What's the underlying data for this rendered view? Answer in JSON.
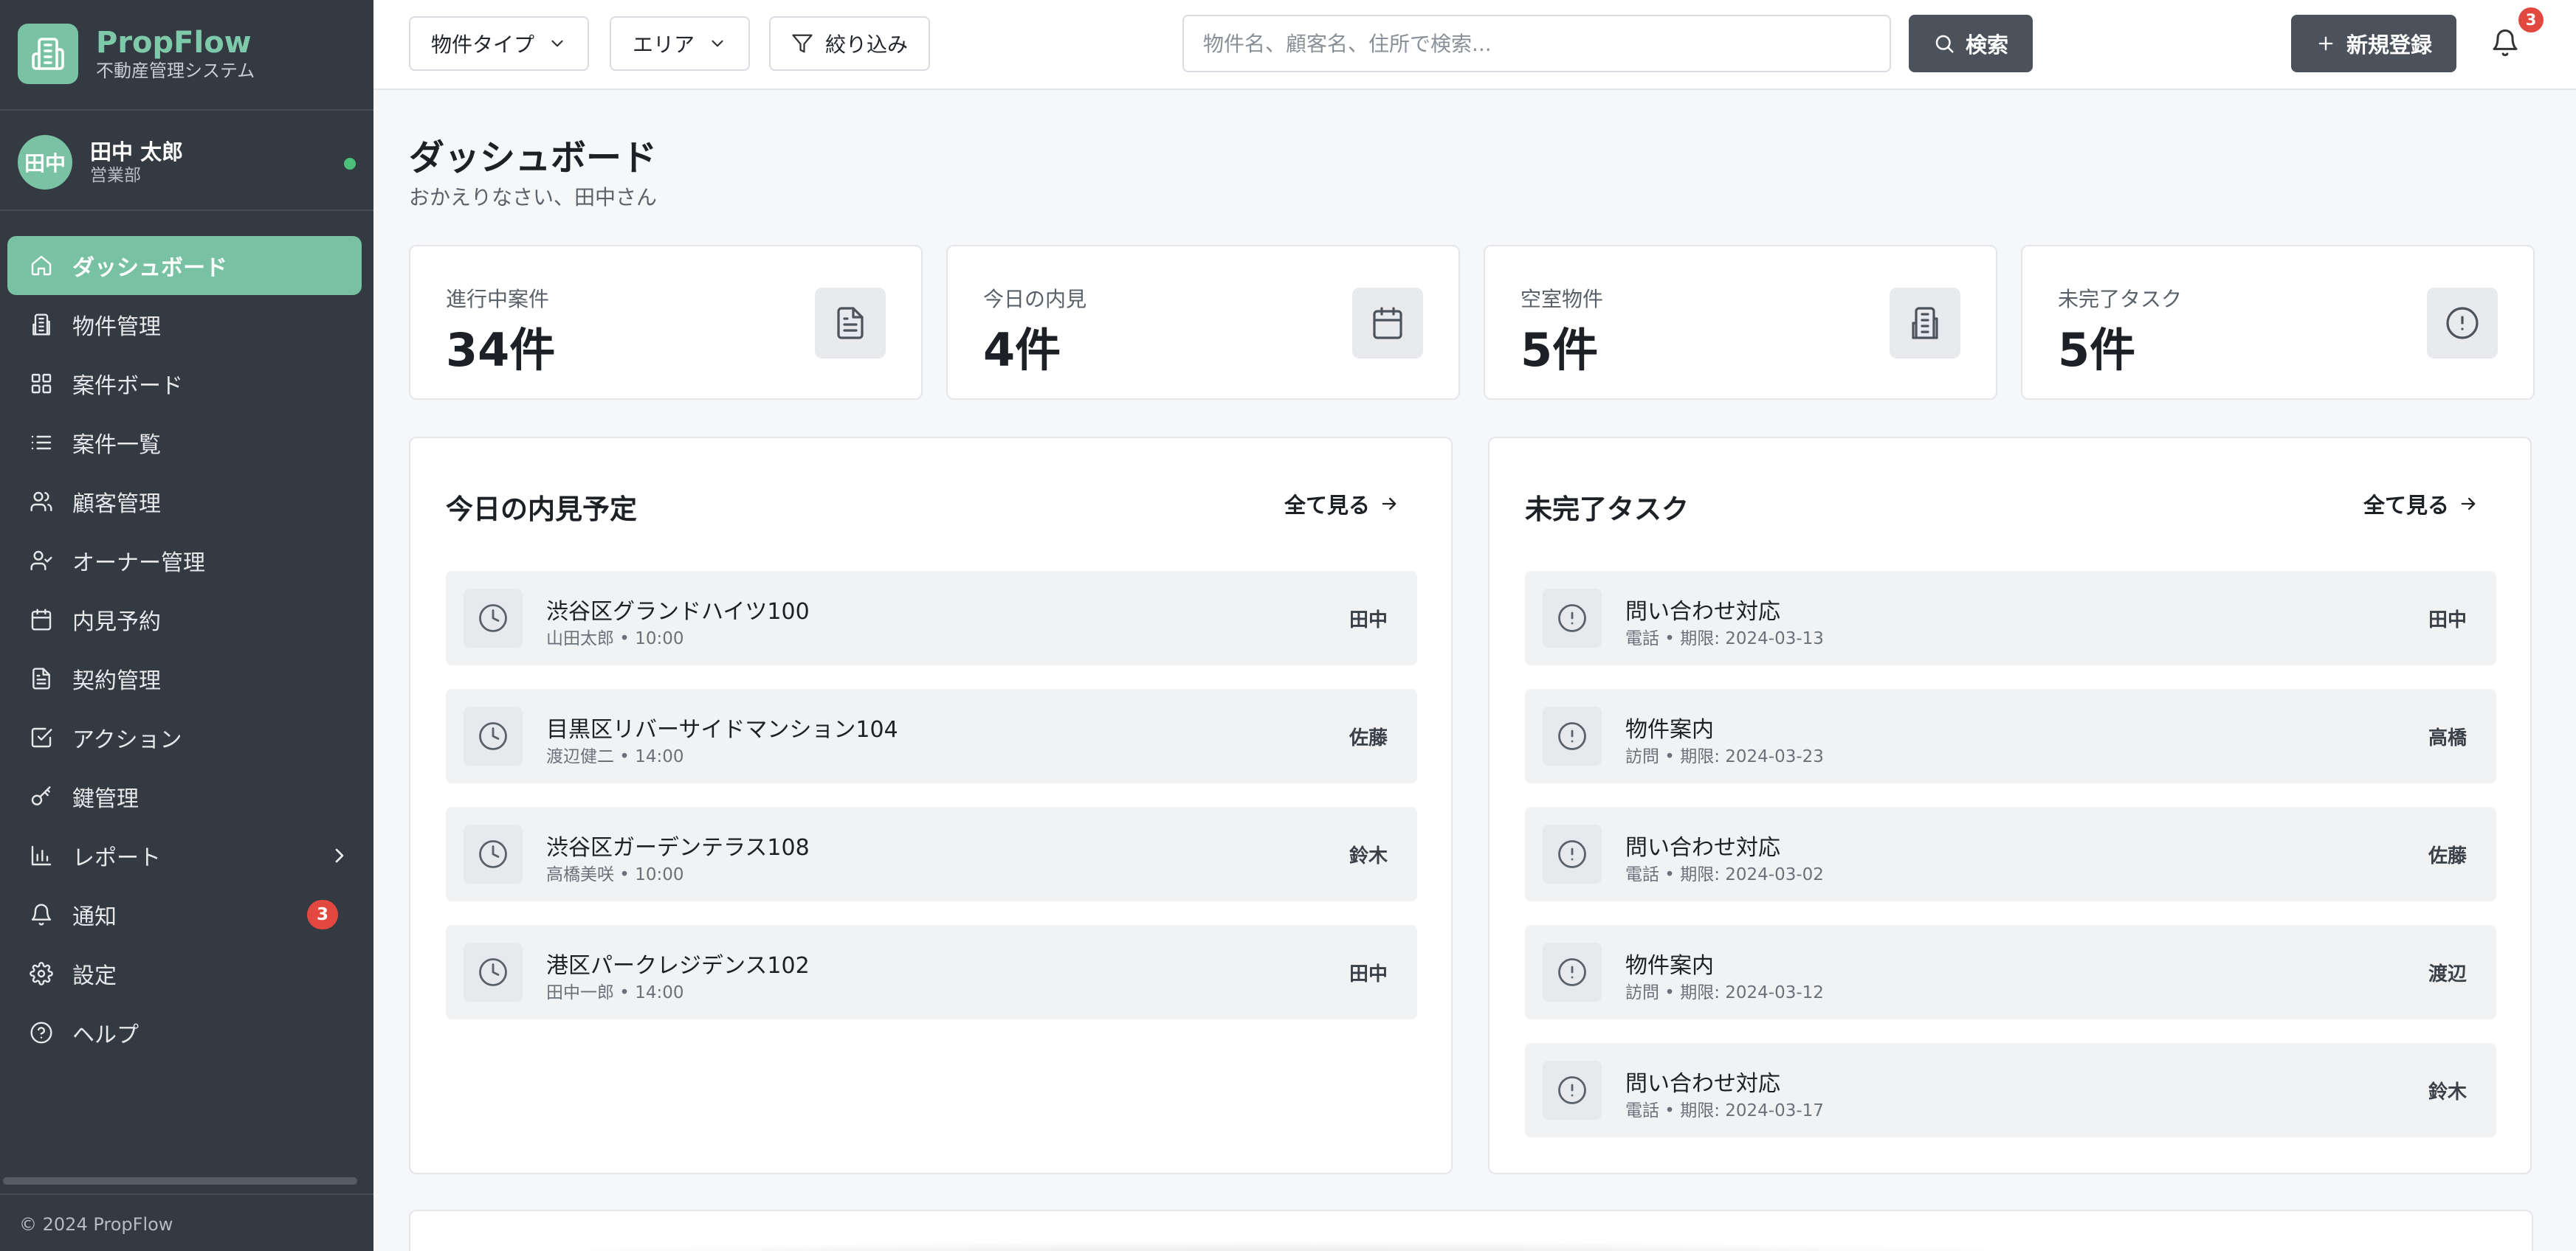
{
  "brand": {
    "name": "PropFlow",
    "subtitle": "不動産管理システム"
  },
  "user": {
    "initials": "田中",
    "name": "田中 太郎",
    "department": "営業部",
    "status": "online"
  },
  "nav": {
    "items": [
      {
        "label": "ダッシュボード",
        "icon": "home-icon",
        "active": true
      },
      {
        "label": "物件管理",
        "icon": "building-icon"
      },
      {
        "label": "案件ボード",
        "icon": "grid-icon"
      },
      {
        "label": "案件一覧",
        "icon": "list-icon"
      },
      {
        "label": "顧客管理",
        "icon": "users-icon"
      },
      {
        "label": "オーナー管理",
        "icon": "user-check-icon"
      },
      {
        "label": "内見予約",
        "icon": "calendar-icon"
      },
      {
        "label": "契約管理",
        "icon": "document-icon"
      },
      {
        "label": "アクション",
        "icon": "check-square-icon"
      },
      {
        "label": "鍵管理",
        "icon": "key-icon"
      },
      {
        "label": "レポート",
        "icon": "bar-chart-icon"
      },
      {
        "label": "通知",
        "icon": "bell-icon",
        "badge": "3"
      },
      {
        "label": "設定",
        "icon": "gear-icon"
      },
      {
        "label": "ヘルプ",
        "icon": "help-icon"
      }
    ]
  },
  "footer": {
    "copyright": "© 2024 PropFlow"
  },
  "header": {
    "property_type_label": "物件タイプ",
    "area_label": "エリア",
    "filter_label": "絞り込み",
    "search_placeholder": "物件名、顧客名、住所で検索...",
    "search_value": "",
    "search_button": "検索",
    "new_button": "新規登録",
    "notification_count": "3"
  },
  "page": {
    "title": "ダッシュボード",
    "subtitle": "おかえりなさい、田中さん"
  },
  "stats": [
    {
      "label": "進行中案件",
      "value": "34件",
      "icon": "document-icon"
    },
    {
      "label": "今日の内見",
      "value": "4件",
      "icon": "calendar-icon"
    },
    {
      "label": "空室物件",
      "value": "5件",
      "icon": "building-icon"
    },
    {
      "label": "未完了タスク",
      "value": "5件",
      "icon": "alert-circle-icon"
    }
  ],
  "viewings": {
    "title": "今日の内見予定",
    "view_all": "全て見る",
    "items": [
      {
        "property": "渋谷区グランドハイツ100",
        "detail": "山田太郎 • 10:00",
        "agent": "田中"
      },
      {
        "property": "目黒区リバーサイドマンション104",
        "detail": "渡辺健二 • 14:00",
        "agent": "佐藤"
      },
      {
        "property": "渋谷区ガーデンテラス108",
        "detail": "高橋美咲 • 10:00",
        "agent": "鈴木"
      },
      {
        "property": "港区パークレジデンス102",
        "detail": "田中一郎 • 14:00",
        "agent": "田中"
      }
    ]
  },
  "tasks": {
    "title": "未完了タスク",
    "view_all": "全て見る",
    "items": [
      {
        "task": "問い合わせ対応",
        "detail": "電話 • 期限: 2024-03-13",
        "assignee": "田中"
      },
      {
        "task": "物件案内",
        "detail": "訪問 • 期限: 2024-03-23",
        "assignee": "高橋"
      },
      {
        "task": "問い合わせ対応",
        "detail": "電話 • 期限: 2024-03-02",
        "assignee": "佐藤"
      },
      {
        "task": "物件案内",
        "detail": "訪問 • 期限: 2024-03-12",
        "assignee": "渡辺"
      },
      {
        "task": "問い合わせ対応",
        "detail": "電話 • 期限: 2024-03-17",
        "assignee": "鈴木"
      }
    ]
  },
  "colors": {
    "accent": "#78c2a3",
    "sidebar": "#343a41",
    "badge": "#e2483f",
    "dark_button": "#4b525b"
  }
}
